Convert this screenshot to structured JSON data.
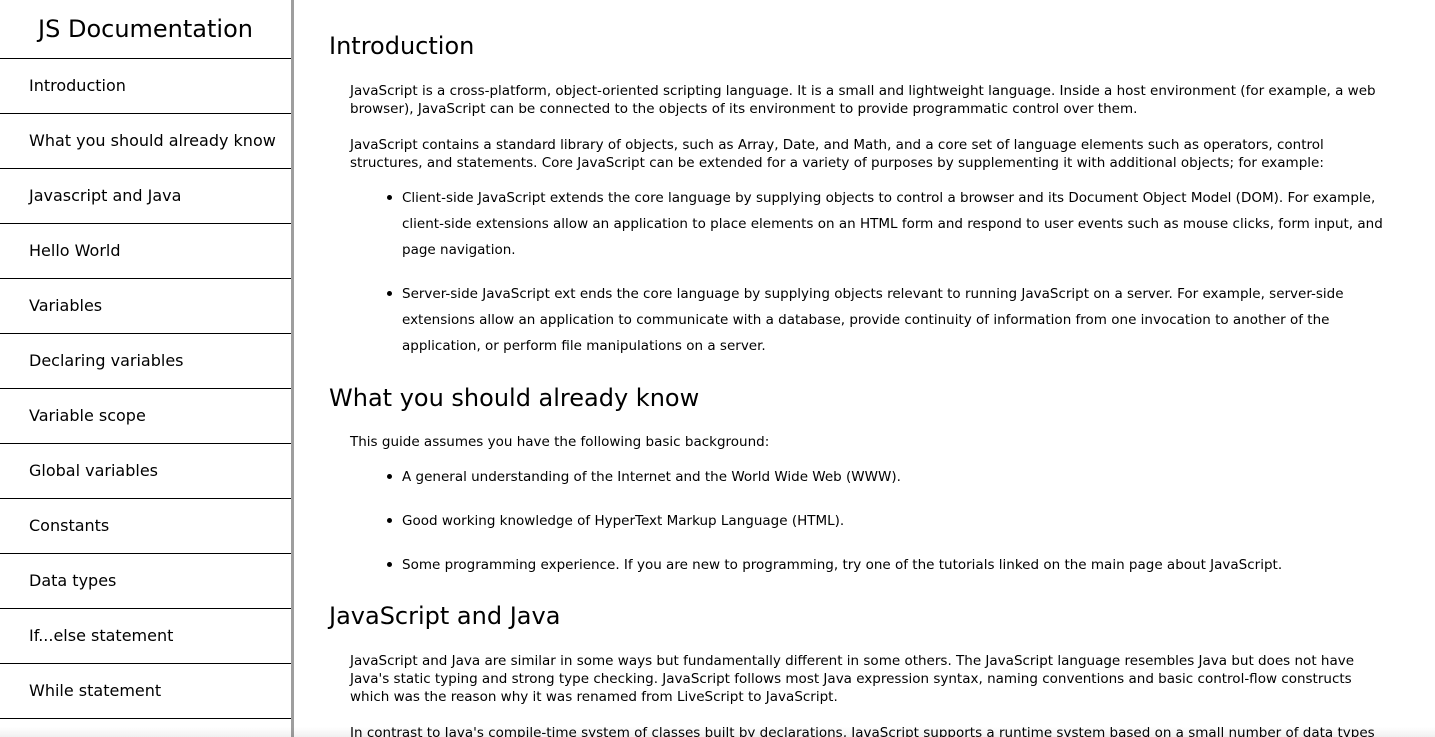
{
  "navbar": {
    "title": "JS Documentation",
    "links": [
      "Introduction",
      "What you should already know",
      "Javascript and Java",
      "Hello World",
      "Variables",
      "Declaring variables",
      "Variable scope",
      "Global variables",
      "Constants",
      "Data types",
      "If...else statement",
      "While statement"
    ]
  },
  "main": {
    "introduction": {
      "header": "Introduction",
      "p1": "JavaScript is a cross-platform, object-oriented scripting language. It is a small and lightweight language. Inside a host environment (for example, a web browser), JavaScript can be connected to the objects of its environment to provide programmatic control over them.",
      "p2": "JavaScript contains a standard library of objects, such as Array, Date, and Math, and a core set of language elements such as operators, control structures, and statements. Core JavaScript can be extended for a variety of purposes by supplementing it with additional objects; for example:",
      "bullets": [
        "Client-side JavaScript extends the core language by supplying objects to control a browser and its Document Object Model (DOM). For example, client-side extensions allow an application to place elements on an HTML form and respond to user events such as mouse clicks, form input, and page navigation.",
        "Server-side JavaScript ext ends the core language by supplying objects relevant to running JavaScript on a server. For example, server-side extensions allow an application to communicate with a database, provide continuity of information from one invocation to another of the application, or perform file manipulations on a server."
      ]
    },
    "know": {
      "header": "What you should already know",
      "p1": "This guide assumes you have the following basic background:",
      "bullets": [
        "A general understanding of the Internet and the World Wide Web (WWW).",
        "Good working knowledge of HyperText Markup Language (HTML).",
        "Some programming experience. If you are new to programming, try one of the tutorials linked on the main page about JavaScript."
      ]
    },
    "java": {
      "header": "JavaScript and Java",
      "p1": "JavaScript and Java are similar in some ways but fundamentally different in some others. The JavaScript language resembles Java but does not have Java's static typing and strong type checking. JavaScript follows most Java expression syntax, naming conventions and basic control-flow constructs which was the reason why it was renamed from LiveScript to JavaScript.",
      "p2": "In contrast to Java's compile-time system of classes built by declarations, JavaScript supports a runtime system based on a small number of data types representing"
    }
  }
}
